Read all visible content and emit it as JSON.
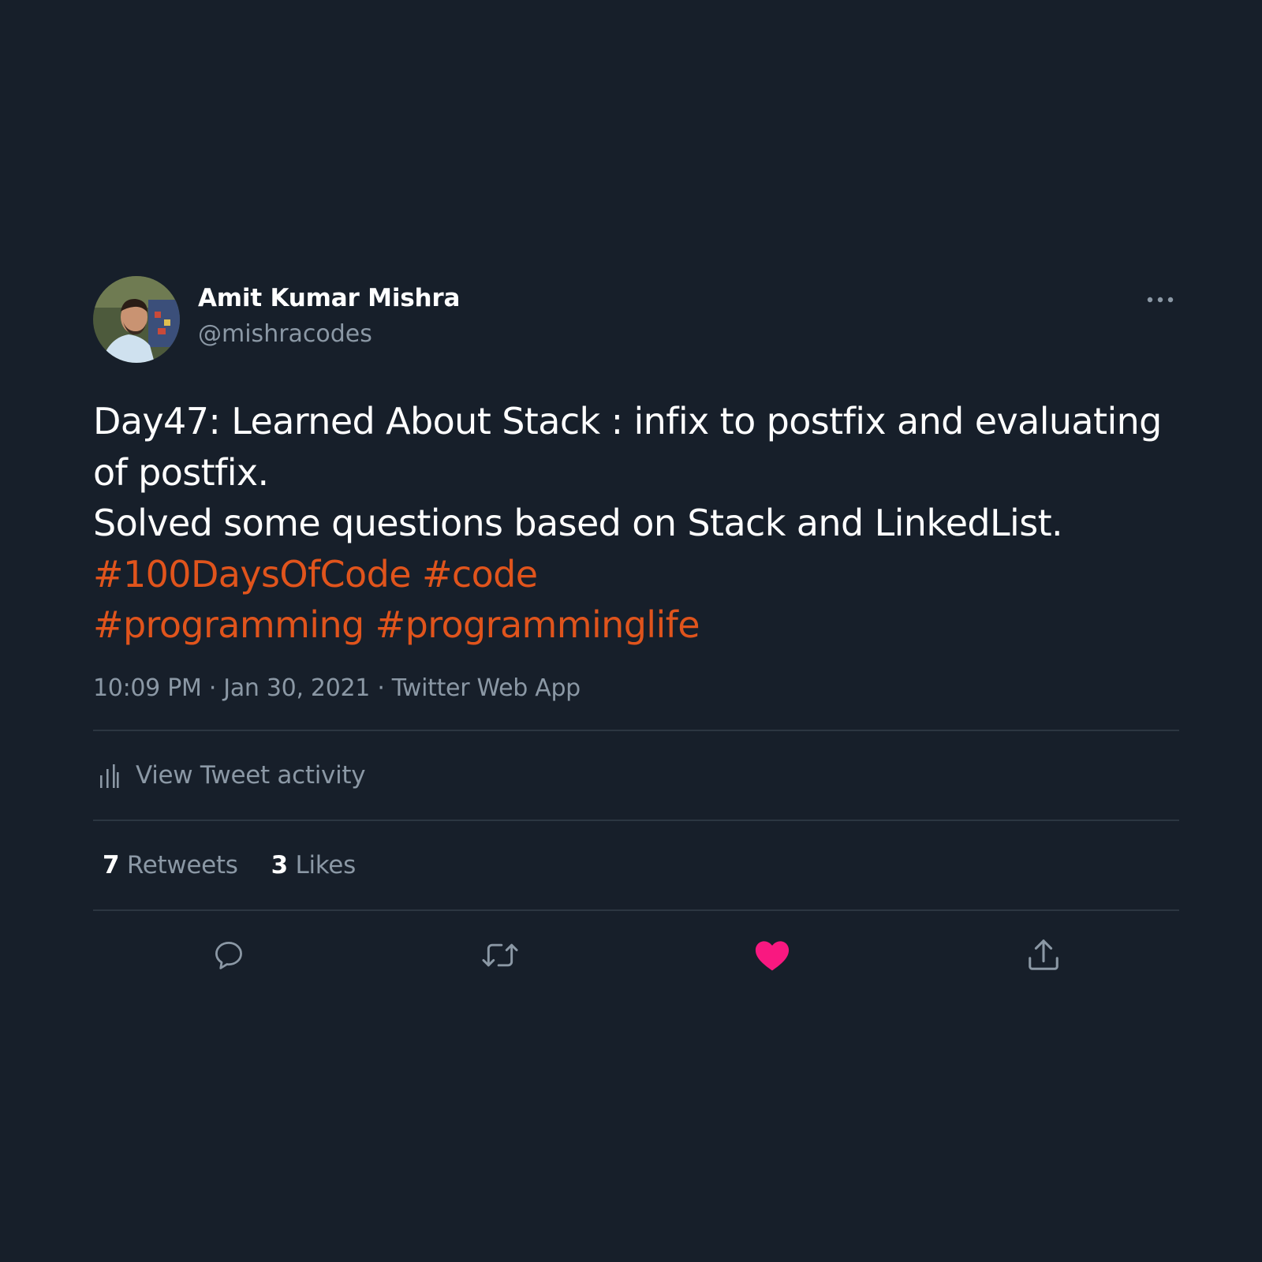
{
  "user": {
    "display_name": "Amit Kumar Mishra",
    "handle": "@mishracodes",
    "avatar_icon": "profile-photo"
  },
  "more_icon": "more-horizontal-icon",
  "tweet": {
    "lines": [
      {
        "text": "Day47: Learned About Stack : infix to postfix and evaluating"
      },
      {
        "text": "of postfix."
      },
      {
        "text": "Solved some questions based on Stack and LinkedList."
      }
    ],
    "hashtag_lines": [
      [
        "#100DaysOfCode",
        "#code"
      ],
      [
        "#programming",
        "#programminglife"
      ]
    ]
  },
  "meta": {
    "time": "10:09 PM",
    "sep1": " · ",
    "date": "Jan 30, 2021",
    "sep2": " · ",
    "source": "Twitter Web App"
  },
  "activity": {
    "label": "View Tweet activity",
    "icon": "bar-chart-icon"
  },
  "stats": {
    "retweets_count": "7",
    "retweets_label": "Retweets",
    "likes_count": "3",
    "likes_label": "Likes"
  },
  "actions": [
    {
      "name": "reply",
      "icon": "reply-icon"
    },
    {
      "name": "retweet",
      "icon": "retweet-icon"
    },
    {
      "name": "like",
      "icon": "heart-icon",
      "state": "liked"
    },
    {
      "name": "share",
      "icon": "share-icon"
    }
  ],
  "colors": {
    "background": "#171f2a",
    "text_primary": "#ffffff",
    "text_secondary": "#8b98a5",
    "hashtag": "#e0541c",
    "like_active": "#f91880",
    "divider": "#2c3641"
  }
}
